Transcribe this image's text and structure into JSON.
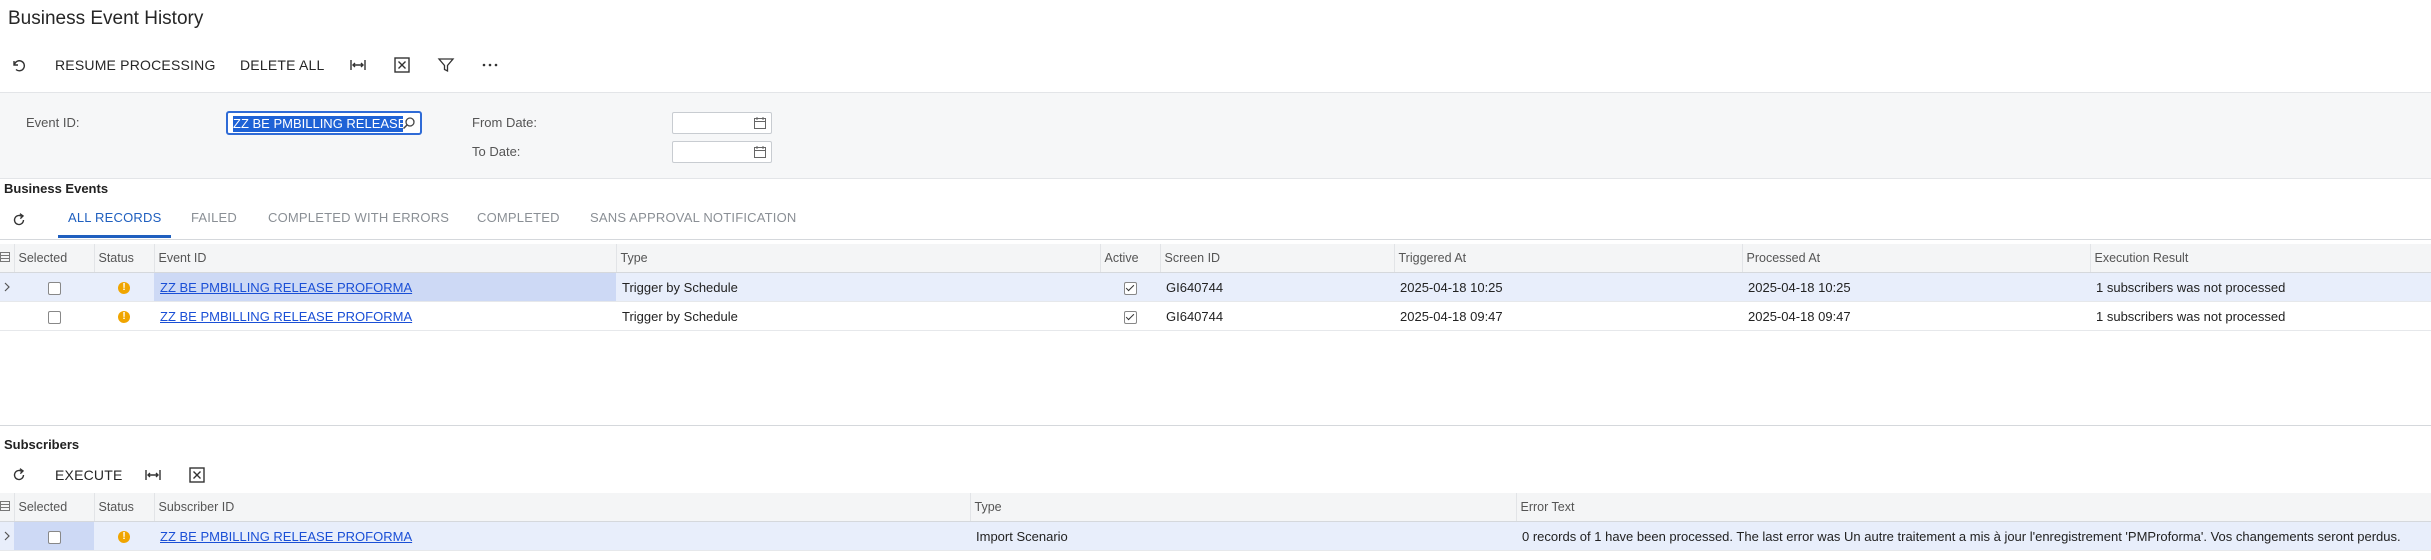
{
  "page": {
    "title": "Business Event History"
  },
  "toolbar": {
    "undo_icon": "undo-icon",
    "resume_label": "RESUME PROCESSING",
    "delete_all_label": "DELETE ALL",
    "fit_icon": "fit-columns-icon",
    "excel_icon": "export-excel-icon",
    "filter_icon": "filter-icon",
    "more_icon": "more-icon"
  },
  "filters": {
    "event_id_label": "Event ID:",
    "event_id_value": "ZZ BE PMBILLING RELEASE PROFORMA",
    "from_date_label": "From Date:",
    "from_date_value": "",
    "to_date_label": "To Date:",
    "to_date_value": ""
  },
  "events": {
    "section_title": "Business Events",
    "tabs": [
      "ALL RECORDS",
      "FAILED",
      "COMPLETED WITH ERRORS",
      "COMPLETED",
      "SANS APPROVAL NOTIFICATION"
    ],
    "active_tab": "ALL RECORDS",
    "columns": [
      "Selected",
      "Status",
      "Event ID",
      "Type",
      "Active",
      "Screen ID",
      "Triggered At",
      "Processed At",
      "Execution Result"
    ],
    "rows": [
      {
        "selected": false,
        "status": "warning",
        "event_id": "ZZ BE PMBILLING RELEASE PROFORMA",
        "type": "Trigger by Schedule",
        "active": true,
        "screen_id": "GI640744",
        "triggered_at": "2025-04-18 10:25",
        "processed_at": "2025-04-18 10:25",
        "result": "1 subscribers was not processed"
      },
      {
        "selected": false,
        "status": "warning",
        "event_id": "ZZ BE PMBILLING RELEASE PROFORMA",
        "type": "Trigger by Schedule",
        "active": true,
        "screen_id": "GI640744",
        "triggered_at": "2025-04-18 09:47",
        "processed_at": "2025-04-18 09:47",
        "result": "1 subscribers was not processed"
      }
    ]
  },
  "subscribers": {
    "section_title": "Subscribers",
    "execute_label": "EXECUTE",
    "columns": [
      "Selected",
      "Status",
      "Subscriber ID",
      "Type",
      "Error Text"
    ],
    "rows": [
      {
        "selected": false,
        "status": "warning",
        "subscriber_id": "ZZ BE PMBILLING RELEASE PROFORMA",
        "type": "Import Scenario",
        "error_text": "0 records of 1 have been processed. The last error was Un autre traitement a mis à jour l'enregistrement 'PMProforma'. Vos changements seront perdus."
      }
    ]
  }
}
